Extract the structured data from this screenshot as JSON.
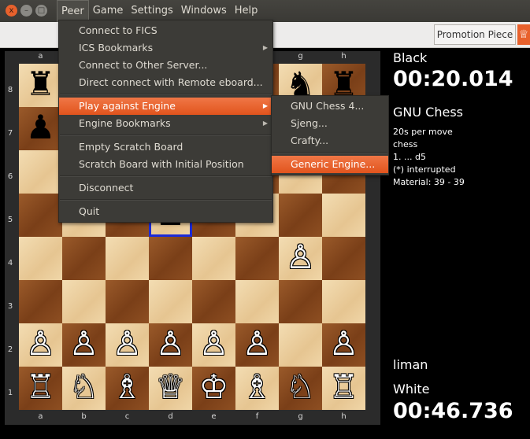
{
  "window_controls": {
    "close": "x",
    "minimize": "–",
    "maximize": "□"
  },
  "menubar": [
    "Peer",
    "Game",
    "Settings",
    "Windows",
    "Help"
  ],
  "toolbar": {
    "promotion_label": "Promotion Piece",
    "promotion_icon": "♕"
  },
  "board": {
    "files": [
      "a",
      "b",
      "c",
      "d",
      "e",
      "f",
      "g",
      "h"
    ],
    "ranks": [
      "8",
      "7",
      "6",
      "5",
      "4",
      "3",
      "2",
      "1"
    ],
    "rows": [
      [
        "♜",
        "",
        "",
        "",
        "",
        "",
        "♞",
        "♜"
      ],
      [
        "♟",
        "",
        "",
        "",
        "",
        "",
        "",
        ""
      ],
      [
        "",
        "",
        "",
        "",
        "",
        "",
        "",
        ""
      ],
      [
        "",
        "",
        "",
        "♟",
        "",
        "",
        "",
        ""
      ],
      [
        "",
        "",
        "",
        "",
        "",
        "",
        "♙",
        ""
      ],
      [
        "",
        "",
        "",
        "",
        "",
        "",
        "",
        ""
      ],
      [
        "♙",
        "♙",
        "♙",
        "♙",
        "♙",
        "♙",
        "",
        "♙"
      ],
      [
        "♖",
        "♘",
        "♗",
        "♕",
        "♔",
        "♗",
        "♘",
        "♖"
      ]
    ],
    "colors": [
      [
        "b",
        "",
        "",
        "",
        "",
        "",
        "b",
        "b"
      ],
      [
        "b",
        "",
        "",
        "",
        "",
        "",
        "",
        ""
      ],
      [
        "",
        "",
        "",
        "",
        "",
        "",
        "",
        ""
      ],
      [
        "",
        "",
        "",
        "b",
        "",
        "",
        "",
        ""
      ],
      [
        "",
        "",
        "",
        "",
        "",
        "",
        "w",
        ""
      ],
      [
        "",
        "",
        "",
        "",
        "",
        "",
        "",
        ""
      ],
      [
        "w",
        "w",
        "w",
        "w",
        "w",
        "w",
        "",
        "w"
      ],
      [
        "w",
        "w",
        "w",
        "w",
        "w",
        "w",
        "w",
        "w"
      ]
    ],
    "highlight_color": "#1b2bd8"
  },
  "info": {
    "black_label": "Black",
    "black_clock": "00:20.014",
    "engine_name": "GNU Chess",
    "details": [
      "20s per move",
      "chess",
      "1. ... d5",
      "(*) interrupted",
      "Material: 39 - 39"
    ],
    "white_player": "liman",
    "white_label": "White",
    "white_clock": "00:46.736"
  },
  "peer_menu": {
    "group1": [
      "Connect to FICS",
      "ICS Bookmarks",
      "Connect to Other Server...",
      "Direct connect with Remote eboard..."
    ],
    "group2": [
      "Play against Engine",
      "Engine Bookmarks"
    ],
    "group3": [
      "Empty Scratch Board",
      "Scratch Board with Initial Position"
    ],
    "group4": [
      "Disconnect"
    ],
    "group5": [
      "Quit"
    ]
  },
  "engine_menu": {
    "group1": [
      "GNU Chess 4...",
      "Sjeng...",
      "Crafty..."
    ],
    "group2": [
      "Generic Engine..."
    ]
  },
  "colors": {
    "accent": "#e8612c",
    "highlight_start": "#f07746",
    "highlight_end": "#e1541d"
  }
}
